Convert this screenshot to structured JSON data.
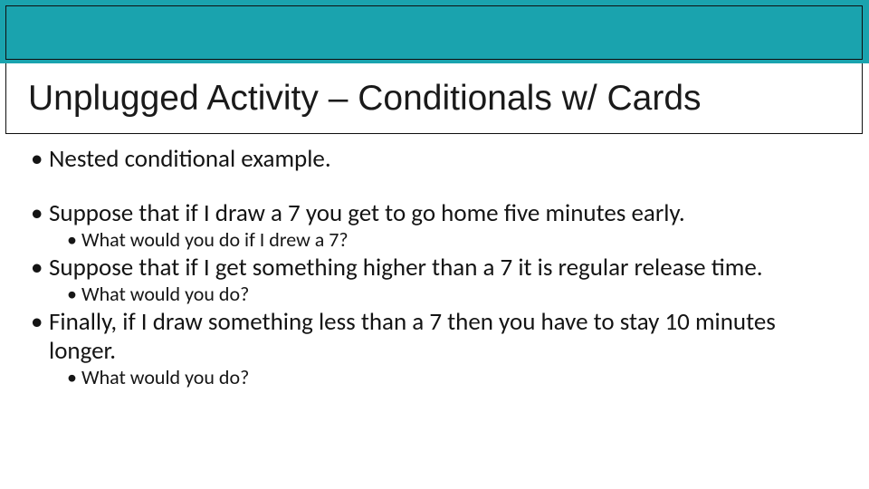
{
  "title": "Unplugged Activity – Conditionals w/ Cards",
  "bullets": {
    "b1": "Nested conditional example.",
    "b2": "Suppose that if I draw a 7 you get to go home five minutes early.",
    "b2a": "What would you do if I drew a 7?",
    "b3": "Suppose that if I get something higher than a 7 it is regular release time.",
    "b3a": "What would you do?",
    "b4": "Finally, if I draw something less than a 7 then you have to stay 10 minutes longer.",
    "b4a": "What would you do?"
  },
  "colors": {
    "accent": "#1aa3ae",
    "frame": "#0f0f0f"
  }
}
